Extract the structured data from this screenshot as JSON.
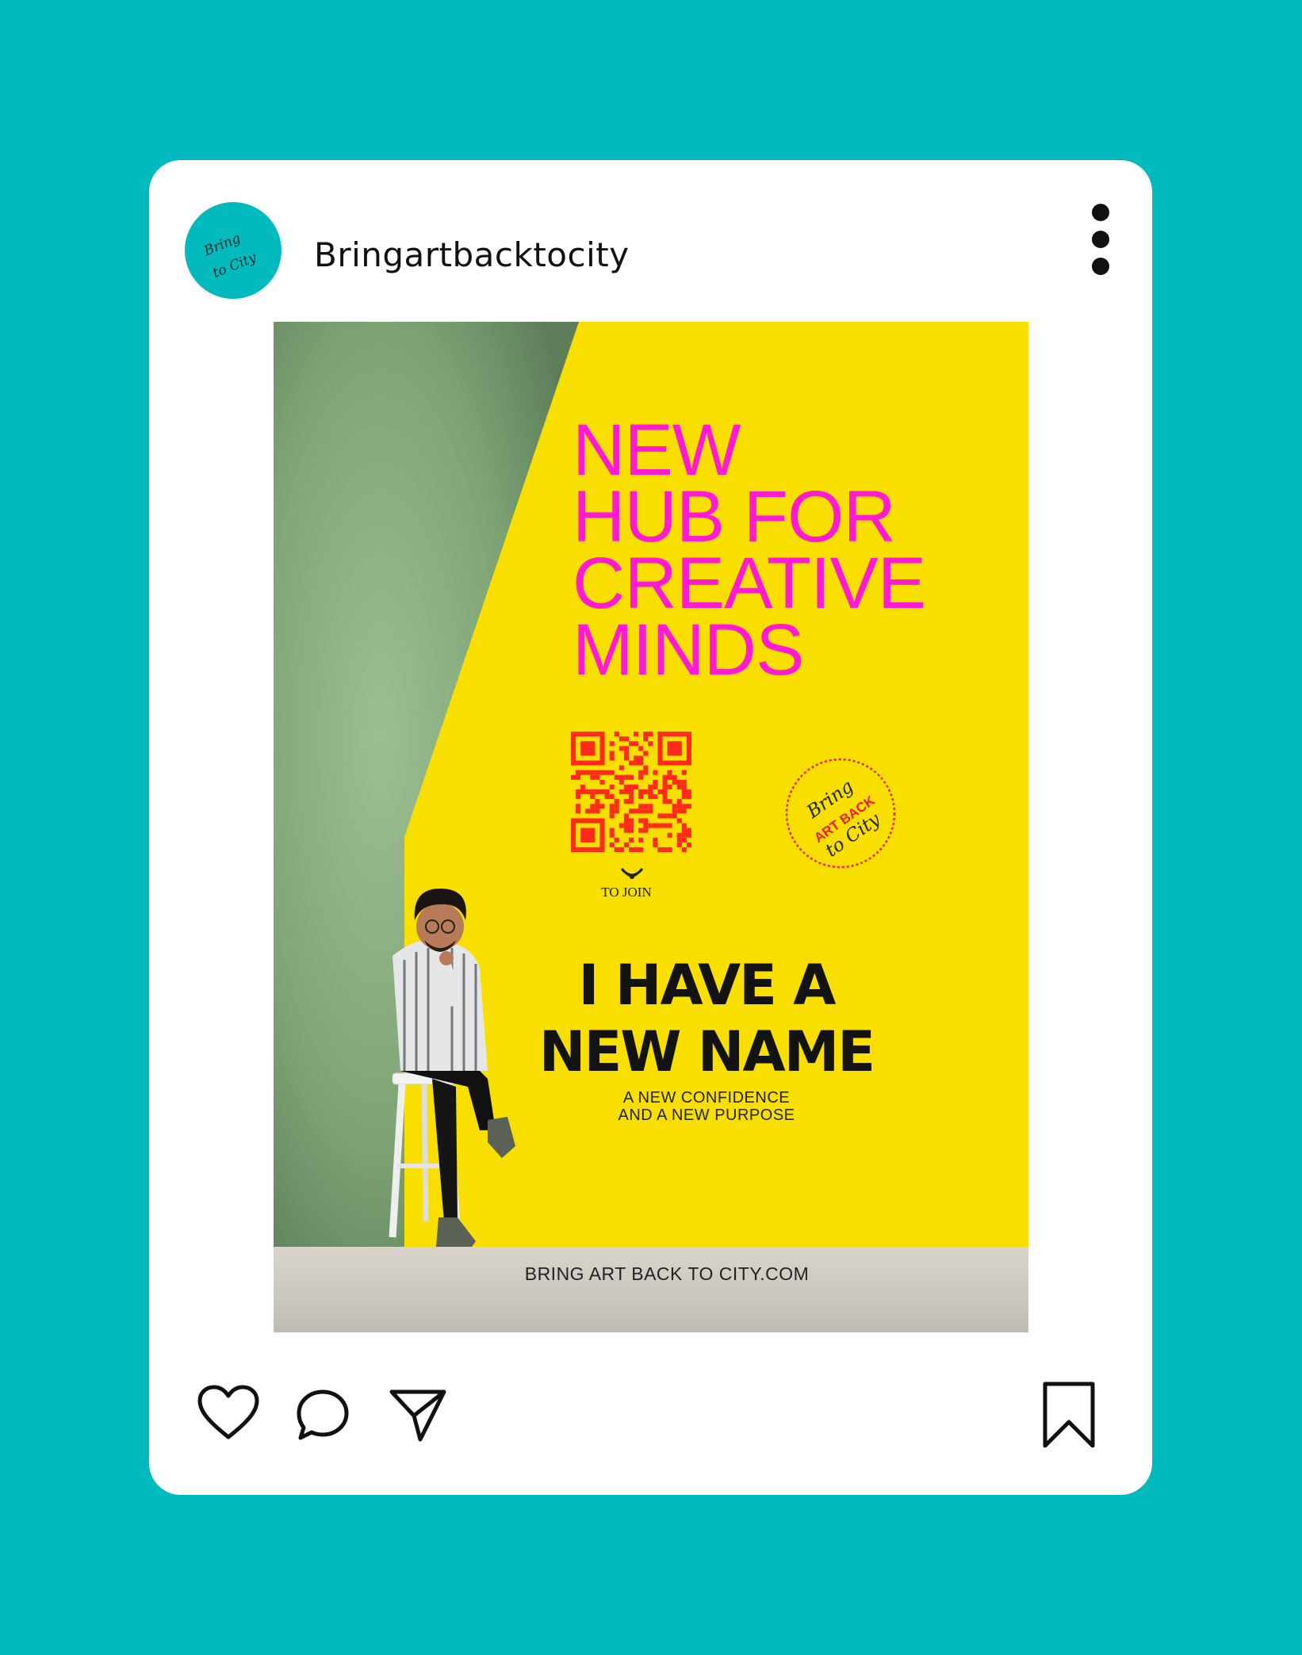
{
  "post": {
    "username": "Bringartbacktocity",
    "avatar_text_line1": "Bring",
    "avatar_text_line2": "to City"
  },
  "poster": {
    "headline_lines": [
      "NEW",
      "HUB FOR",
      "CREATIVE",
      "MINDS"
    ],
    "qr_caption": "TO JOIN",
    "stamp_top": "Bring",
    "stamp_middle": "ART BACK",
    "stamp_bottom": "to City",
    "name_line1": "I HAVE A",
    "name_line2": "NEW NAME",
    "sub_line1": "A NEW CONFIDENCE",
    "sub_line2": "AND A NEW PURPOSE",
    "website": "BRING ART BACK TO CITY.COM"
  },
  "actions": {
    "icons": [
      "heart-icon",
      "comment-icon",
      "share-icon",
      "bookmark-icon",
      "more-icon"
    ]
  },
  "colors": {
    "background": "#02babe",
    "card": "#ffffff",
    "poster_yellow": "#f8df00",
    "headline_magenta": "#ff1bd3",
    "qr_red": "#ff2a1a",
    "wall_green": "#6a8e66"
  }
}
